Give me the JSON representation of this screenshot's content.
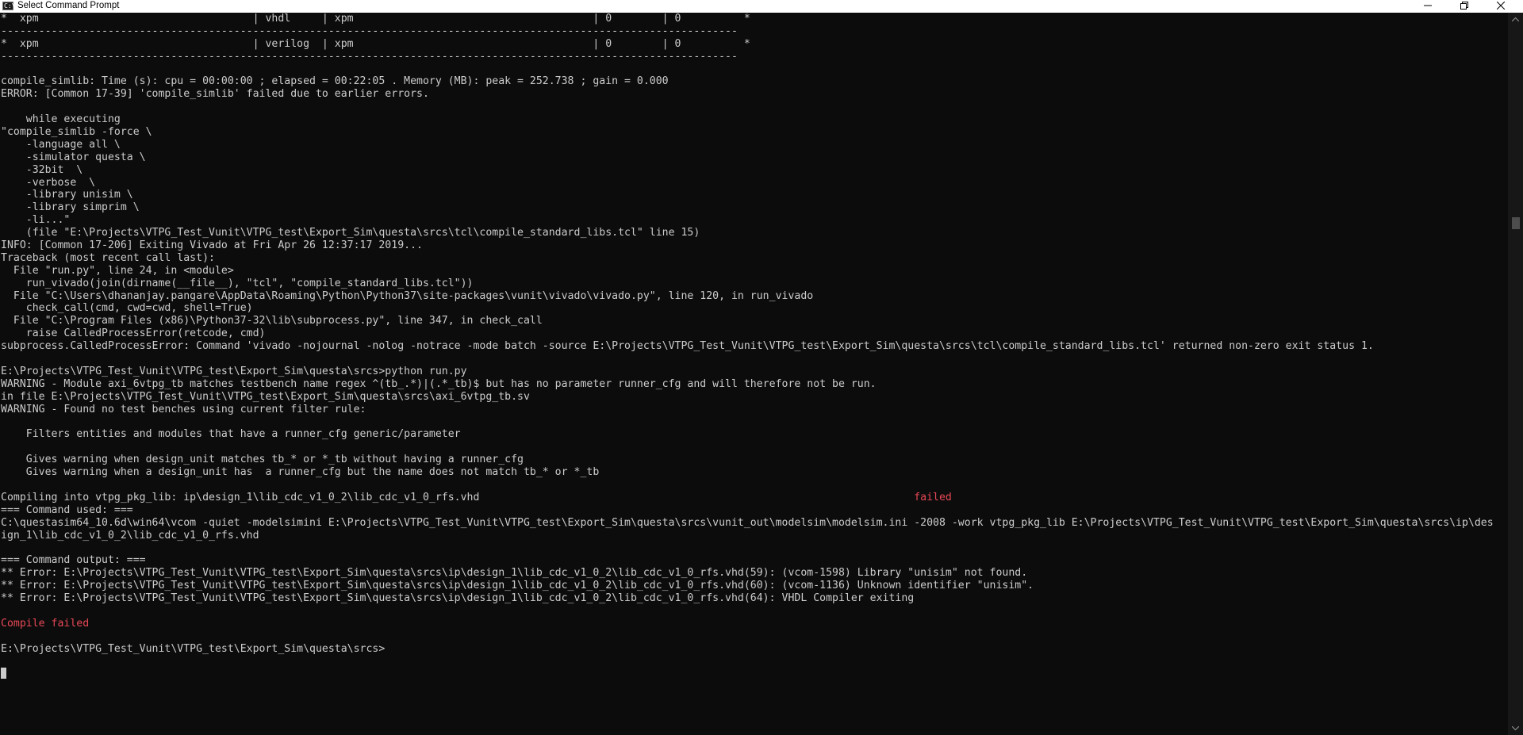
{
  "window": {
    "title": "Select Command Prompt",
    "icon": "cmd-icon",
    "icon_glyph": "C:\\"
  },
  "controls": {
    "minimize_icon": "minimize-icon",
    "maximize_icon": "restore-icon",
    "close_icon": "close-icon"
  },
  "colors": {
    "background": "#0c0c0c",
    "text": "#cccccc",
    "error_red": "#e74856",
    "titlebar": "#ffffff"
  },
  "console": {
    "lines": [
      {
        "text": "*  xpm                                  | vhdl     | xpm                                      | 0        | 0          *"
      },
      {
        "text": "---------------------------------------------------------------------------------------------------------------------"
      },
      {
        "text": "*  xpm                                  | verilog  | xpm                                      | 0        | 0          *"
      },
      {
        "text": "---------------------------------------------------------------------------------------------------------------------"
      },
      {
        "text": ""
      },
      {
        "text": "compile_simlib: Time (s): cpu = 00:00:00 ; elapsed = 00:22:05 . Memory (MB): peak = 252.738 ; gain = 0.000"
      },
      {
        "text": "ERROR: [Common 17-39] 'compile_simlib' failed due to earlier errors."
      },
      {
        "text": ""
      },
      {
        "text": "    while executing"
      },
      {
        "text": "\"compile_simlib -force \\"
      },
      {
        "text": "    -language all \\"
      },
      {
        "text": "    -simulator questa \\"
      },
      {
        "text": "    -32bit  \\"
      },
      {
        "text": "    -verbose  \\"
      },
      {
        "text": "    -library unisim \\"
      },
      {
        "text": "    -library simprim \\"
      },
      {
        "text": "    -li...\""
      },
      {
        "text": "    (file \"E:\\Projects\\VTPG_Test_Vunit\\VTPG_test\\Export_Sim\\questa\\srcs\\tcl\\compile_standard_libs.tcl\" line 15)"
      },
      {
        "text": "INFO: [Common 17-206] Exiting Vivado at Fri Apr 26 12:37:17 2019..."
      },
      {
        "text": "Traceback (most recent call last):"
      },
      {
        "text": "  File \"run.py\", line 24, in <module>"
      },
      {
        "text": "    run_vivado(join(dirname(__file__), \"tcl\", \"compile_standard_libs.tcl\"))"
      },
      {
        "text": "  File \"C:\\Users\\dhananjay.pangare\\AppData\\Roaming\\Python\\Python37\\site-packages\\vunit\\vivado\\vivado.py\", line 120, in run_vivado"
      },
      {
        "text": "    check_call(cmd, cwd=cwd, shell=True)"
      },
      {
        "text": "  File \"C:\\Program Files (x86)\\Python37-32\\lib\\subprocess.py\", line 347, in check_call"
      },
      {
        "text": "    raise CalledProcessError(retcode, cmd)"
      },
      {
        "text": "subprocess.CalledProcessError: Command 'vivado -nojournal -nolog -notrace -mode batch -source E:\\Projects\\VTPG_Test_Vunit\\VTPG_test\\Export_Sim\\questa\\srcs\\tcl\\compile_standard_libs.tcl' returned non-zero exit status 1."
      },
      {
        "text": ""
      },
      {
        "text": "E:\\Projects\\VTPG_Test_Vunit\\VTPG_test\\Export_Sim\\questa\\srcs>python run.py"
      },
      {
        "text": "WARNING - Module axi_6vtpg_tb matches testbench name regex ^(tb_.*)|(.*_tb)$ but has no parameter runner_cfg and will therefore not be run."
      },
      {
        "text": "in file E:\\Projects\\VTPG_Test_Vunit\\VTPG_test\\Export_Sim\\questa\\srcs\\axi_6vtpg_tb.sv"
      },
      {
        "text": "WARNING - Found no test benches using current filter rule:"
      },
      {
        "text": ""
      },
      {
        "text": "    Filters entities and modules that have a runner_cfg generic/parameter"
      },
      {
        "text": ""
      },
      {
        "text": "    Gives warning when design_unit matches tb_* or *_tb without having a runner_cfg"
      },
      {
        "text": "    Gives warning when a design_unit has  a runner_cfg but the name does not match tb_* or *_tb"
      },
      {
        "text": ""
      },
      {
        "text": "Compiling into vtpg_pkg_lib: ip\\design_1\\lib_cdc_v1_0_2\\lib_cdc_v1_0_rfs.vhd                                                                     ",
        "status": "failed"
      },
      {
        "text": "=== Command used: ==="
      },
      {
        "text": "C:\\questasim64_10.6d\\win64\\vcom -quiet -modelsimini E:\\Projects\\VTPG_Test_Vunit\\VTPG_test\\Export_Sim\\questa\\srcs\\vunit_out\\modelsim\\modelsim.ini -2008 -work vtpg_pkg_lib E:\\Projects\\VTPG_Test_Vunit\\VTPG_test\\Export_Sim\\questa\\srcs\\ip\\des"
      },
      {
        "text": "ign_1\\lib_cdc_v1_0_2\\lib_cdc_v1_0_rfs.vhd"
      },
      {
        "text": ""
      },
      {
        "text": "=== Command output: ==="
      },
      {
        "text": "** Error: E:\\Projects\\VTPG_Test_Vunit\\VTPG_test\\Export_Sim\\questa\\srcs\\ip\\design_1\\lib_cdc_v1_0_2\\lib_cdc_v1_0_rfs.vhd(59): (vcom-1598) Library \"unisim\" not found."
      },
      {
        "text": "** Error: E:\\Projects\\VTPG_Test_Vunit\\VTPG_test\\Export_Sim\\questa\\srcs\\ip\\design_1\\lib_cdc_v1_0_2\\lib_cdc_v1_0_rfs.vhd(60): (vcom-1136) Unknown identifier \"unisim\"."
      },
      {
        "text": "** Error: E:\\Projects\\VTPG_Test_Vunit\\VTPG_test\\Export_Sim\\questa\\srcs\\ip\\design_1\\lib_cdc_v1_0_2\\lib_cdc_v1_0_rfs.vhd(64): VHDL Compiler exiting"
      },
      {
        "text": ""
      },
      {
        "text": "Compile failed",
        "red": true
      },
      {
        "text": ""
      },
      {
        "text": "E:\\Projects\\VTPG_Test_Vunit\\VTPG_test\\Export_Sim\\questa\\srcs>"
      },
      {
        "text": ""
      },
      {
        "text": "",
        "cursor": true
      }
    ]
  },
  "scrollbar": {
    "position_fraction": 0.28
  }
}
